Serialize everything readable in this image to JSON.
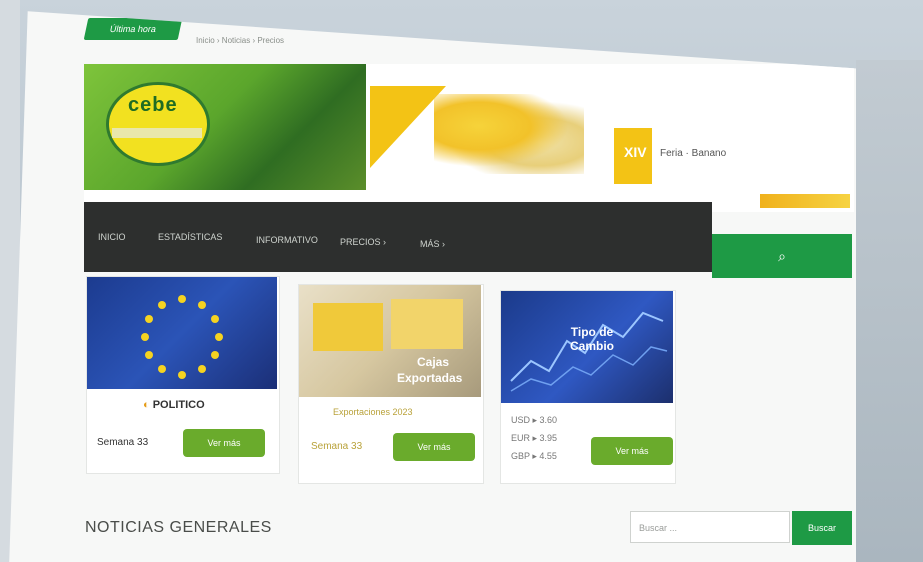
{
  "topbar": {
    "tag": "Última hora",
    "breadcrumb": "Inicio › Noticias › Precios"
  },
  "banner": {
    "logo_text": "cebe",
    "badge_text": "XIV",
    "event_text": "Feria · Banano"
  },
  "nav": {
    "items": [
      "INICIO",
      "ESTADÍSTICAS",
      "INFORMATIVO",
      "PRECIOS ›",
      "MÁS ›"
    ],
    "search_icon": "⌕"
  },
  "cards": [
    {
      "image_name": "european-flag",
      "logo": "POLITICO",
      "meta": "Semana 33",
      "button": "Ver más"
    },
    {
      "image_name": "price-chart-image",
      "image_label_1": "Cajas",
      "image_label_2": "Exportadas",
      "caption": "Exportaciones 2023",
      "meta": "Semana 33",
      "button": "Ver más"
    },
    {
      "image_name": "exchange-chart",
      "image_label": "Tipo de Cambio",
      "rates": [
        "USD ▸ 3.60",
        "EUR ▸ 3.95",
        "GBP ▸ 4.55"
      ],
      "button": "Ver más"
    }
  ],
  "section": {
    "title": "NOTICIAS GENERALES"
  },
  "search": {
    "placeholder": "Buscar ...",
    "button": "Buscar"
  },
  "colors": {
    "accent": "#1e9a45",
    "button": "#6aab2c",
    "nav": "#2d2f2e"
  }
}
